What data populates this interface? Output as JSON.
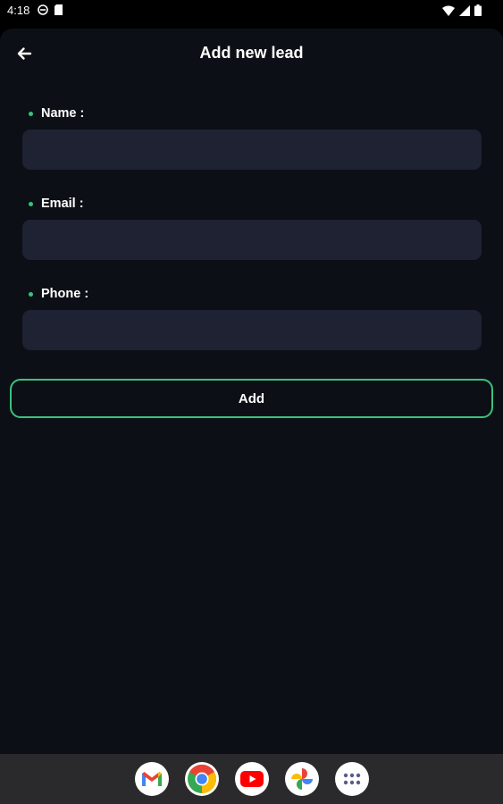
{
  "status_bar": {
    "time": "4:18",
    "left_icons": [
      "settings-circle-icon",
      "sd-card-icon"
    ],
    "right_icons": [
      "wifi-icon",
      "signal-icon",
      "battery-icon"
    ]
  },
  "app_bar": {
    "title": "Add new lead",
    "back_icon": "arrow-left-icon"
  },
  "form": {
    "fields": [
      {
        "label": "Name :",
        "value": "",
        "placeholder": ""
      },
      {
        "label": "Email :",
        "value": "",
        "placeholder": ""
      },
      {
        "label": "Phone :",
        "value": "",
        "placeholder": ""
      }
    ],
    "submit_label": "Add"
  },
  "dock": {
    "apps": [
      "gmail-icon",
      "chrome-icon",
      "youtube-icon",
      "photos-icon",
      "app-drawer-icon"
    ]
  },
  "colors": {
    "background": "#0c1016",
    "input_fill": "#1e2233",
    "accent_green": "#3cc27c",
    "text": "#ffffff"
  }
}
